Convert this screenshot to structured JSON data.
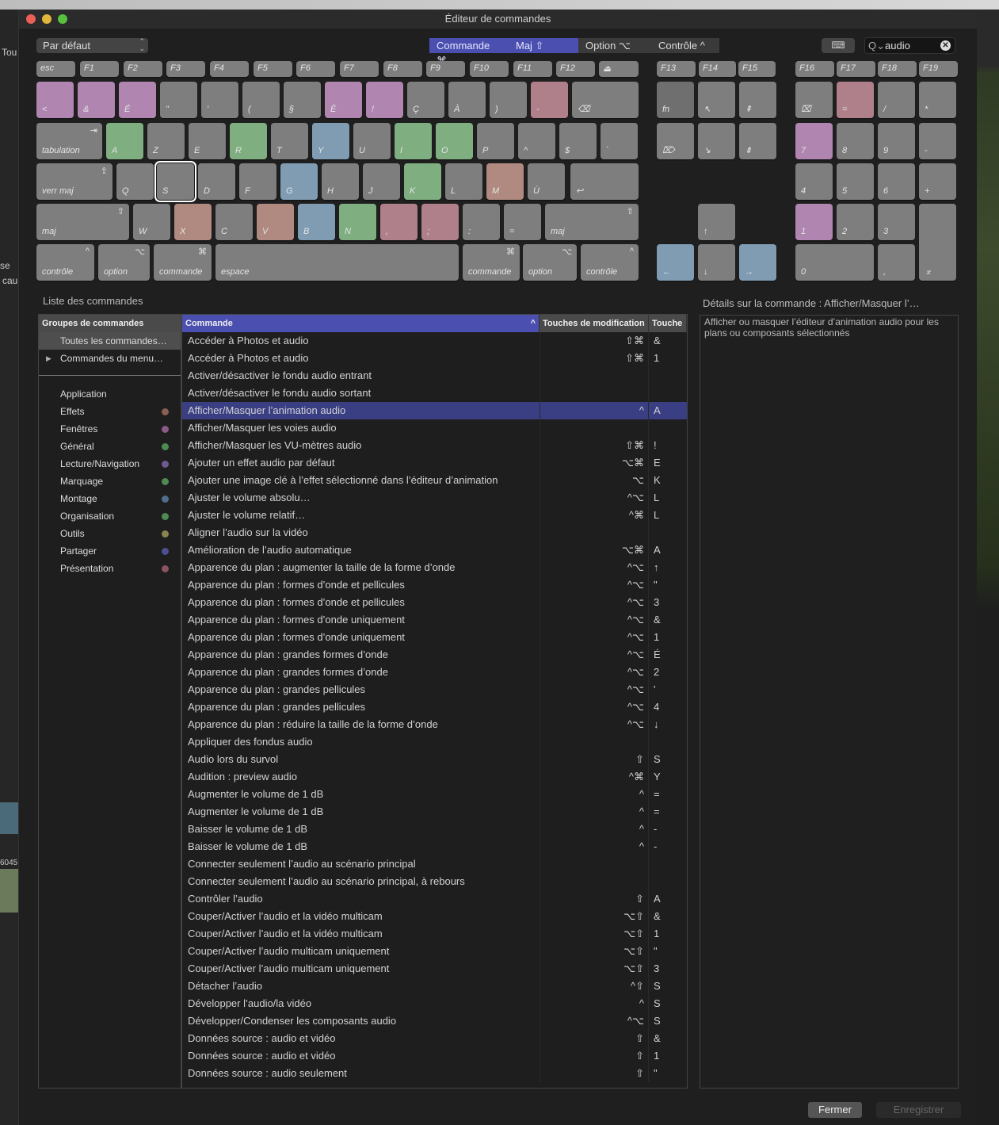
{
  "window": {
    "title": "Éditeur de commandes"
  },
  "background_fragments": {
    "tou": "Tou",
    "se": "se",
    "cau": "cau",
    "num": "6045"
  },
  "toolbar": {
    "preset": "Par défaut",
    "modifiers": [
      {
        "label": "Commande ⌘",
        "active": true
      },
      {
        "label": "Maj ⇧",
        "active": true
      },
      {
        "label": "Option ⌥",
        "active": false
      },
      {
        "label": "Contrôle ^",
        "active": false
      }
    ],
    "keyboard_toggle": "⌨",
    "search_value": "audio",
    "search_icon": "Q⌄"
  },
  "colors": {
    "grey": "#7e7e7e",
    "dark": "#6f6f6f",
    "purple": "#b085b0",
    "green": "#7fae80",
    "blue": "#7f9cb3",
    "pink": "#b0808a",
    "salmon": "#b08a80"
  },
  "keyboard": {
    "function_row": [
      "esc",
      "F1",
      "F2",
      "F3",
      "F4",
      "F5",
      "F6",
      "F7",
      "F8",
      "F9",
      "F10",
      "F11",
      "F12",
      "⏏"
    ],
    "row1": [
      {
        "l": "<",
        "c": "purple"
      },
      {
        "l": "&",
        "c": "purple"
      },
      {
        "l": "É",
        "c": "purple"
      },
      {
        "l": "\"",
        "c": "grey"
      },
      {
        "l": "'",
        "c": "grey"
      },
      {
        "l": "(",
        "c": "grey"
      },
      {
        "l": "§",
        "c": "grey"
      },
      {
        "l": "È",
        "c": "purple"
      },
      {
        "l": "!",
        "c": "purple"
      },
      {
        "l": "Ç",
        "c": "grey"
      },
      {
        "l": "À",
        "c": "grey"
      },
      {
        "l": ")",
        "c": "grey"
      },
      {
        "l": "-",
        "c": "pink"
      },
      {
        "l": "⌫",
        "c": "grey"
      }
    ],
    "row2": [
      {
        "l": "tabulation",
        "m": "⇥",
        "c": "grey"
      },
      {
        "l": "A",
        "c": "green"
      },
      {
        "l": "Z",
        "c": "grey"
      },
      {
        "l": "E",
        "c": "grey"
      },
      {
        "l": "R",
        "c": "green"
      },
      {
        "l": "T",
        "c": "grey"
      },
      {
        "l": "Y",
        "c": "blue"
      },
      {
        "l": "U",
        "c": "grey"
      },
      {
        "l": "I",
        "c": "green"
      },
      {
        "l": "O",
        "c": "green"
      },
      {
        "l": "P",
        "c": "grey"
      },
      {
        "l": "^",
        "c": "grey"
      },
      {
        "l": "$",
        "c": "grey"
      },
      {
        "l": "`",
        "c": "grey"
      }
    ],
    "row3": [
      {
        "l": "verr maj",
        "m": "⇪",
        "c": "grey"
      },
      {
        "l": "Q",
        "c": "grey"
      },
      {
        "l": "S",
        "c": "grey",
        "selected": true
      },
      {
        "l": "D",
        "c": "grey"
      },
      {
        "l": "F",
        "c": "grey"
      },
      {
        "l": "G",
        "c": "blue"
      },
      {
        "l": "H",
        "c": "grey"
      },
      {
        "l": "J",
        "c": "grey"
      },
      {
        "l": "K",
        "c": "green"
      },
      {
        "l": "L",
        "c": "grey"
      },
      {
        "l": "M",
        "c": "salmon"
      },
      {
        "l": "Ù",
        "c": "grey"
      },
      {
        "l": "↩",
        "c": "grey"
      }
    ],
    "row4": [
      {
        "l": "maj",
        "m": "⇧",
        "c": "grey"
      },
      {
        "l": "W",
        "c": "grey"
      },
      {
        "l": "X",
        "c": "salmon"
      },
      {
        "l": "C",
        "c": "grey"
      },
      {
        "l": "V",
        "c": "salmon"
      },
      {
        "l": "B",
        "c": "blue"
      },
      {
        "l": "N",
        "c": "green"
      },
      {
        "l": ",",
        "c": "pink"
      },
      {
        "l": ";",
        "c": "pink"
      },
      {
        "l": ":",
        "c": "grey"
      },
      {
        "l": "=",
        "c": "grey"
      },
      {
        "l": "maj",
        "m": "⇧",
        "c": "grey"
      }
    ],
    "row5": [
      {
        "l": "contrôle",
        "m": "^",
        "c": "grey"
      },
      {
        "l": "option",
        "m": "⌥",
        "c": "grey"
      },
      {
        "l": "commande",
        "m": "⌘",
        "c": "grey"
      },
      {
        "l": "espace",
        "c": "grey"
      },
      {
        "l": "commande",
        "m": "⌘",
        "c": "grey"
      },
      {
        "l": "option",
        "m": "⌥",
        "c": "grey"
      },
      {
        "l": "contrôle",
        "m": "^",
        "c": "grey"
      }
    ],
    "nav_function": [
      "F13",
      "F14",
      "F15"
    ],
    "nav": [
      {
        "l": "fn",
        "c": "dark"
      },
      {
        "l": "↖",
        "c": "grey"
      },
      {
        "l": "⇞",
        "c": "grey"
      },
      {
        "l": "⌦",
        "c": "grey"
      },
      {
        "l": "↘",
        "c": "grey"
      },
      {
        "l": "⇟",
        "c": "grey"
      },
      {
        "l": "↑",
        "c": "grey"
      },
      {
        "l": "←",
        "c": "blue"
      },
      {
        "l": "↓",
        "c": "grey"
      },
      {
        "l": "→",
        "c": "blue"
      }
    ],
    "numpad_function": [
      "F16",
      "F17",
      "F18",
      "F19"
    ],
    "numpad": [
      {
        "l": "⌧",
        "c": "grey"
      },
      {
        "l": "=",
        "c": "pink"
      },
      {
        "l": "/",
        "c": "grey"
      },
      {
        "l": "*",
        "c": "grey"
      },
      {
        "l": "7",
        "c": "purple"
      },
      {
        "l": "8",
        "c": "grey"
      },
      {
        "l": "9",
        "c": "grey"
      },
      {
        "l": "-",
        "c": "grey"
      },
      {
        "l": "4",
        "c": "grey"
      },
      {
        "l": "5",
        "c": "grey"
      },
      {
        "l": "6",
        "c": "grey"
      },
      {
        "l": "+",
        "c": "grey"
      },
      {
        "l": "1",
        "c": "purple"
      },
      {
        "l": "2",
        "c": "grey"
      },
      {
        "l": "3",
        "c": "grey"
      },
      {
        "l": "⌅",
        "c": "grey"
      },
      {
        "l": "0",
        "c": "grey"
      },
      {
        "l": ",",
        "c": "grey"
      }
    ]
  },
  "command_list": {
    "title": "Liste des commandes",
    "groups_header": "Groupes de commandes",
    "groups_top": [
      {
        "label": "Toutes les commandes…",
        "selected": true
      },
      {
        "label": "Commandes du menu…",
        "expandable": true
      }
    ],
    "groups": [
      {
        "label": "Application",
        "color": ""
      },
      {
        "label": "Effets",
        "color": "#8a5e54"
      },
      {
        "label": "Fenêtres",
        "color": "#8a5a86"
      },
      {
        "label": "Général",
        "color": "#4f8a52"
      },
      {
        "label": "Lecture/Navigation",
        "color": "#6e5a92"
      },
      {
        "label": "Marquage",
        "color": "#4f8a52"
      },
      {
        "label": "Montage",
        "color": "#4e6e8c"
      },
      {
        "label": "Organisation",
        "color": "#4f8a52"
      },
      {
        "label": "Outils",
        "color": "#8a8450"
      },
      {
        "label": "Partager",
        "color": "#4c4f92"
      },
      {
        "label": "Présentation",
        "color": "#8a5460"
      }
    ],
    "columns": [
      "Commande",
      "Touches de modification",
      "Touche"
    ],
    "rows": [
      [
        "Accéder à Photos et audio",
        "⇧⌘",
        "&"
      ],
      [
        "Accéder à Photos et audio",
        "⇧⌘",
        "1"
      ],
      [
        "Activer/désactiver le fondu audio entrant",
        "",
        ""
      ],
      [
        "Activer/désactiver le fondu audio sortant",
        "",
        ""
      ],
      [
        "Afficher/Masquer l’animation audio",
        "^",
        "A"
      ],
      [
        "Afficher/Masquer les voies audio",
        "",
        ""
      ],
      [
        "Afficher/Masquer les VU-mètres audio",
        "⇧⌘",
        "!"
      ],
      [
        "Ajouter un effet audio par défaut",
        "⌥⌘",
        "E"
      ],
      [
        "Ajouter une image clé à l’effet sélectionné dans l’éditeur d’animation",
        "⌥",
        "K"
      ],
      [
        "Ajuster le volume absolu…",
        "^⌥",
        "L"
      ],
      [
        "Ajuster le volume relatif…",
        "^⌘",
        "L"
      ],
      [
        "Aligner l’audio sur la vidéo",
        "",
        ""
      ],
      [
        "Amélioration de l’audio automatique",
        "⌥⌘",
        "A"
      ],
      [
        "Apparence du plan : augmenter la taille de la forme d’onde",
        "^⌥",
        "↑"
      ],
      [
        "Apparence du plan : formes d’onde et pellicules",
        "^⌥",
        "\""
      ],
      [
        "Apparence du plan : formes d’onde et pellicules",
        "^⌥",
        "3"
      ],
      [
        "Apparence du plan : formes d’onde uniquement",
        "^⌥",
        "&"
      ],
      [
        "Apparence du plan : formes d’onde uniquement",
        "^⌥",
        "1"
      ],
      [
        "Apparence du plan : grandes formes d’onde",
        "^⌥",
        "É"
      ],
      [
        "Apparence du plan : grandes formes d’onde",
        "^⌥",
        "2"
      ],
      [
        "Apparence du plan : grandes pellicules",
        "^⌥",
        "'"
      ],
      [
        "Apparence du plan : grandes pellicules",
        "^⌥",
        "4"
      ],
      [
        "Apparence du plan : réduire la taille de la forme d’onde",
        "^⌥",
        "↓"
      ],
      [
        "Appliquer des fondus audio",
        "",
        ""
      ],
      [
        "Audio lors du survol",
        "⇧",
        "S"
      ],
      [
        "Audition : preview audio",
        "^⌘",
        "Y"
      ],
      [
        "Augmenter le volume de 1 dB",
        "^",
        "="
      ],
      [
        "Augmenter le volume de 1 dB",
        "^",
        "="
      ],
      [
        "Baisser le volume de 1 dB",
        "^",
        "-"
      ],
      [
        "Baisser le volume de 1 dB",
        "^",
        "-"
      ],
      [
        "Connecter seulement l’audio au scénario principal",
        "",
        ""
      ],
      [
        "Connecter seulement l’audio au scénario principal, à rebours",
        "",
        ""
      ],
      [
        "Contrôler l’audio",
        "⇧",
        "A"
      ],
      [
        "Couper/Activer l’audio et la vidéo multicam",
        "⌥⇧",
        "&"
      ],
      [
        "Couper/Activer l’audio et la vidéo multicam",
        "⌥⇧",
        "1"
      ],
      [
        "Couper/Activer l’audio multicam uniquement",
        "⌥⇧",
        "\""
      ],
      [
        "Couper/Activer l’audio multicam uniquement",
        "⌥⇧",
        "3"
      ],
      [
        "Détacher l’audio",
        "^⇧",
        "S"
      ],
      [
        "Développer l’audio/la vidéo",
        "^",
        "S"
      ],
      [
        "Développer/Condenser les composants audio",
        "^⌥",
        "S"
      ],
      [
        "Données source : audio et vidéo",
        "⇧",
        "&"
      ],
      [
        "Données source : audio et vidéo",
        "⇧",
        "1"
      ],
      [
        "Données source : audio seulement",
        "⇧",
        "\""
      ]
    ],
    "selected_row": 4
  },
  "details": {
    "title": "Détails sur la commande : Afficher/Masquer l’…",
    "text": "Afficher ou masquer l’éditeur d’animation audio pour les plans ou composants sélectionnés"
  },
  "footer": {
    "close": "Fermer",
    "save": "Enregistrer"
  }
}
